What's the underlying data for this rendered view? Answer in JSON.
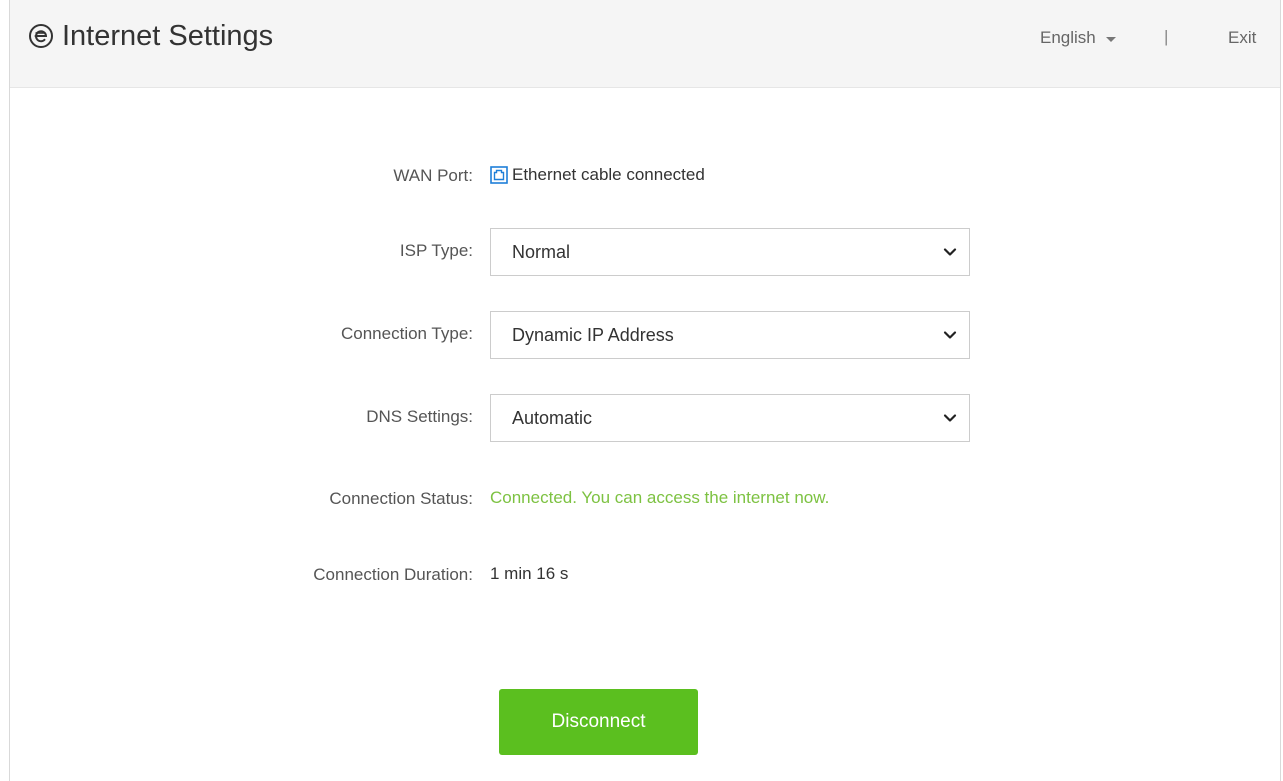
{
  "header": {
    "title": "Internet Settings",
    "title_icon": "internet-e-icon",
    "language": "English",
    "divider": "|",
    "exit_label": "Exit"
  },
  "wan_port": {
    "label": "WAN Port:",
    "icon": "ethernet-port-icon",
    "value": "Ethernet cable connected"
  },
  "isp_type": {
    "label": "ISP Type:",
    "selected": "Normal"
  },
  "connection_type": {
    "label": "Connection Type:",
    "selected": "Dynamic IP Address"
  },
  "dns_settings": {
    "label": "DNS Settings:",
    "selected": "Automatic"
  },
  "connection_status": {
    "label": "Connection Status:",
    "value": "Connected. You can access the internet now."
  },
  "connection_duration": {
    "label": "Connection Duration:",
    "value": "1 min 16 s"
  },
  "actions": {
    "disconnect_label": "Disconnect"
  },
  "colors": {
    "accent_green": "#5bbf1f",
    "status_green": "#7dc242",
    "port_icon_blue": "#1e7fd8"
  }
}
